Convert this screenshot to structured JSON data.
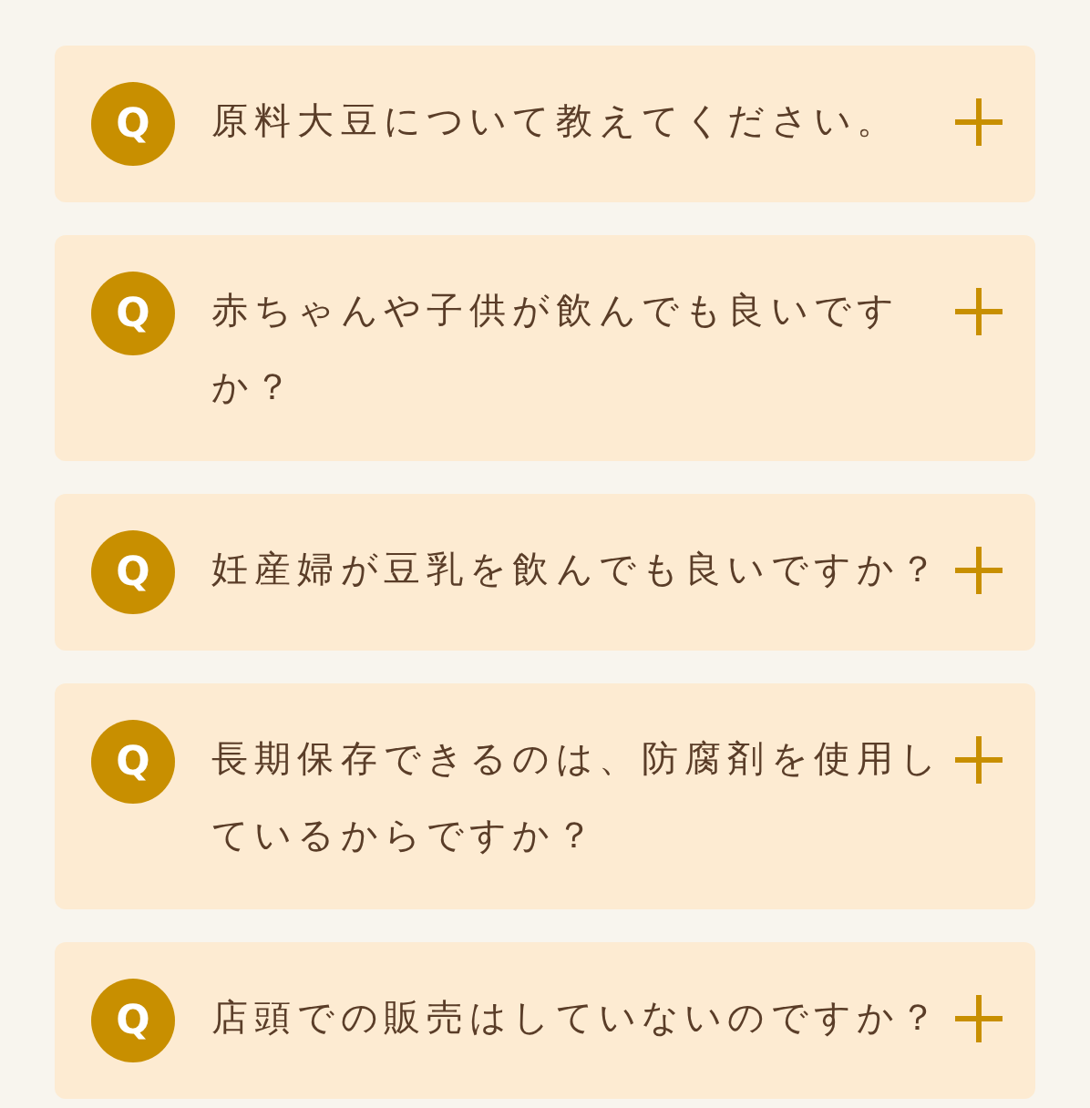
{
  "faq": [
    {
      "badge": "Q",
      "question": "原料大豆について教えてください。",
      "expanded": false
    },
    {
      "badge": "Q",
      "question": "赤ちゃんや子供が飲んでも良いですか？",
      "expanded": false
    },
    {
      "badge": "Q",
      "question": "妊産婦が豆乳を飲んでも良いですか？",
      "expanded": false
    },
    {
      "badge": "Q",
      "question": "長期保存できるのは、防腐剤を使用しているからですか？",
      "expanded": false
    },
    {
      "badge": "Q",
      "question": "店頭での販売はしていないのですか？",
      "expanded": false
    }
  ]
}
